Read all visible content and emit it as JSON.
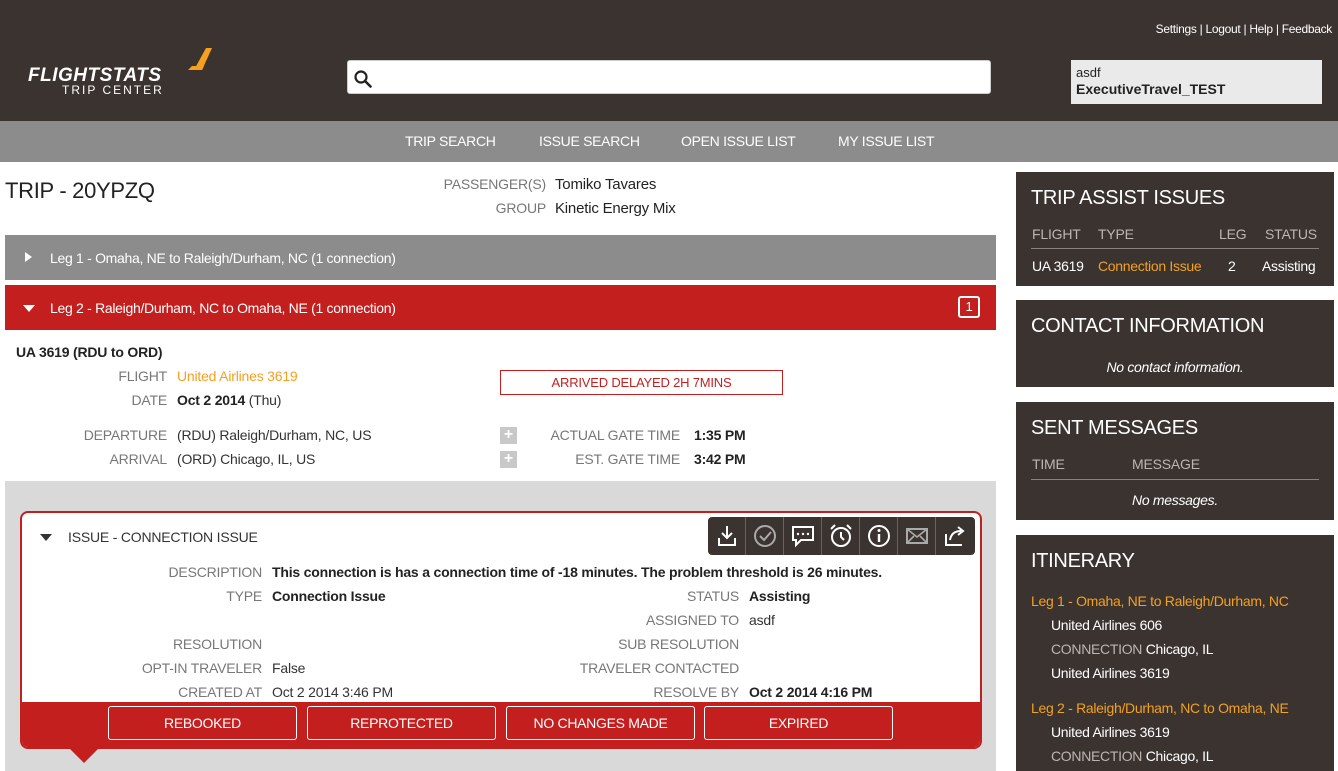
{
  "header": {
    "logo_main": "FLIGHTSTATS",
    "logo_sub": "TRIP CENTER",
    "links": [
      "Settings",
      "Logout",
      "Help",
      "Feedback"
    ],
    "search": {
      "value": "",
      "placeholder": ""
    },
    "user": {
      "name": "asdf",
      "account": "ExecutiveTravel_TEST"
    }
  },
  "nav": [
    "TRIP SEARCH",
    "ISSUE SEARCH",
    "OPEN ISSUE LIST",
    "MY ISSUE LIST"
  ],
  "trip": {
    "title": "TRIP - 20YPZQ",
    "passenger_label": "PASSENGER(S)",
    "passenger": "Tomiko Tavares",
    "group_label": "GROUP",
    "group": "Kinetic Energy Mix"
  },
  "legs": [
    {
      "label": "Leg 1 - Omaha, NE to Raleigh/Durham, NC (1 connection)",
      "expanded": false
    },
    {
      "label": "Leg 2 - Raleigh/Durham, NC to Omaha, NE (1 connection)",
      "expanded": true,
      "issue_count": "1"
    }
  ],
  "flight": {
    "heading": "UA 3619 (RDU to ORD)",
    "flight_label": "FLIGHT",
    "flight_value": "United Airlines 3619",
    "date_label": "DATE",
    "date_bold": "Oct 2 2014",
    "date_day": "(Thu)",
    "status_banner": "ARRIVED DELAYED 2H 7MINS",
    "departure_label": "DEPARTURE",
    "departure_value": "(RDU) Raleigh/Durham, NC, US",
    "arrival_label": "ARRIVAL",
    "arrival_value": "(ORD) Chicago, IL, US",
    "actual_gate_label": "ACTUAL GATE TIME",
    "actual_gate_value": "1:35 PM",
    "est_gate_label": "EST. GATE TIME",
    "est_gate_value": "3:42 PM"
  },
  "issue": {
    "title": "ISSUE - CONNECTION ISSUE",
    "icons": [
      "download-icon",
      "check-circle-icon",
      "chat-icon",
      "alarm-clock-icon",
      "info-icon",
      "mail-icon",
      "share-icon"
    ],
    "description_label": "DESCRIPTION",
    "description": "This connection is has a connection time of -18 minutes. The problem threshold is 26 minutes.",
    "type_label": "TYPE",
    "type": "Connection Issue",
    "status_label": "STATUS",
    "status": "Assisting",
    "assigned_label": "ASSIGNED TO",
    "assigned": "asdf",
    "resolution_label": "RESOLUTION",
    "resolution": "",
    "sub_resolution_label": "SUB RESOLUTION",
    "sub_resolution": "",
    "optin_label": "OPT-IN TRAVELER",
    "optin": "False",
    "contacted_label": "TRAVELER CONTACTED",
    "contacted": "",
    "created_label": "CREATED AT",
    "created": "Oct 2 2014 3:46 PM",
    "resolve_label": "RESOLVE BY",
    "resolve": "Oct 2 2014 4:16 PM",
    "actions": [
      "REBOOKED",
      "REPROTECTED",
      "NO CHANGES MADE",
      "EXPIRED"
    ]
  },
  "sidebar": {
    "trip_assist": {
      "title": "TRIP ASSIST ISSUES",
      "columns": [
        "FLIGHT",
        "TYPE",
        "LEG",
        "STATUS"
      ],
      "rows": [
        {
          "flight": "UA 3619",
          "type": "Connection Issue",
          "leg": "2",
          "status": "Assisting"
        }
      ]
    },
    "contact": {
      "title": "CONTACT INFORMATION",
      "empty": "No contact information."
    },
    "messages": {
      "title": "SENT MESSAGES",
      "columns": [
        "TIME",
        "MESSAGE"
      ],
      "empty": "No messages."
    },
    "itinerary": {
      "title": "ITINERARY",
      "legs": [
        {
          "label": "Leg 1 - Omaha, NE to Raleigh/Durham, NC",
          "flight1": "United Airlines 606",
          "connection_label": "CONNECTION",
          "connection": "Chicago, IL",
          "flight2": "United Airlines 3619"
        },
        {
          "label": "Leg 2 - Raleigh/Durham, NC to Omaha, NE",
          "flight1": "United Airlines 3619",
          "connection_label": "CONNECTION",
          "connection": "Chicago, IL"
        }
      ]
    }
  },
  "colors": {
    "dark": "#3b3330",
    "nav": "#8c8c8c",
    "accent_red": "#c31f1f",
    "accent_orange": "#f5a01e"
  }
}
